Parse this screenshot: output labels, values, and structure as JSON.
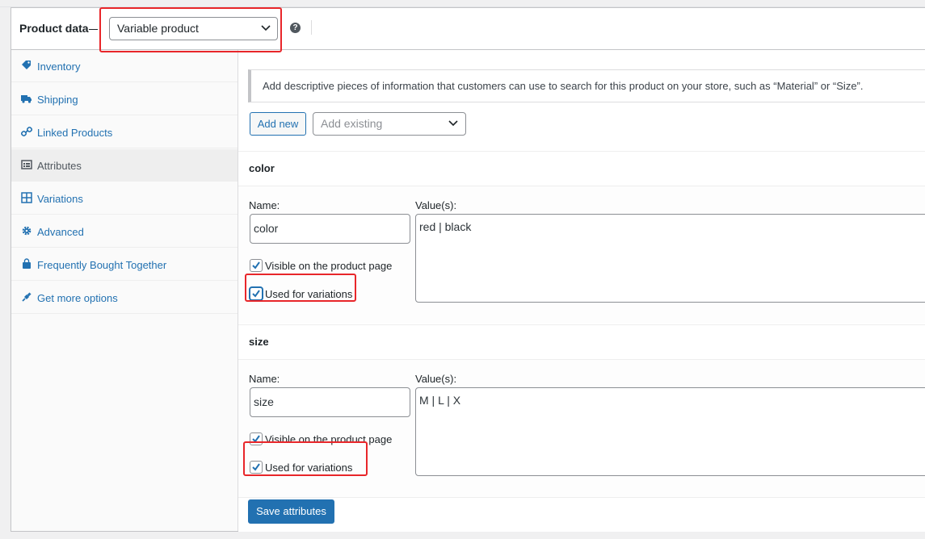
{
  "header": {
    "title": "Product data",
    "product_type": "Variable product",
    "help_glyph": "?"
  },
  "sidebar": {
    "items": [
      {
        "label": "Inventory",
        "icon": "tag-icon"
      },
      {
        "label": "Shipping",
        "icon": "truck-icon"
      },
      {
        "label": "Linked Products",
        "icon": "link-icon"
      },
      {
        "label": "Attributes",
        "icon": "table-icon",
        "active": true
      },
      {
        "label": "Variations",
        "icon": "grid-icon"
      },
      {
        "label": "Advanced",
        "icon": "gear-icon"
      },
      {
        "label": "Frequently Bought Together",
        "icon": "bag-icon"
      },
      {
        "label": "Get more options",
        "icon": "plugin-icon"
      }
    ]
  },
  "main": {
    "notice": "Add descriptive pieces of information that customers can use to search for this product on your store, such as “Material” or “Size”.",
    "add_new_label": "Add new",
    "add_existing_placeholder": "Add existing",
    "attributes": [
      {
        "heading": "color",
        "name_label": "Name:",
        "name_value": "color",
        "values_label": "Value(s):",
        "values": "red | black",
        "visible_label": "Visible on the product page",
        "visible_checked": true,
        "variations_label": "Used for variations",
        "variations_checked": true
      },
      {
        "heading": "size",
        "name_label": "Name:",
        "name_value": "size",
        "values_label": "Value(s):",
        "values": "M | L | X",
        "visible_label": "Visible on the product page",
        "visible_checked": true,
        "variations_label": "Used for variations",
        "variations_checked": true
      }
    ],
    "save_label": "Save attributes"
  },
  "colors": {
    "link": "#2271b1",
    "highlight": "#e8262a",
    "primary_button": "#2271b1"
  }
}
